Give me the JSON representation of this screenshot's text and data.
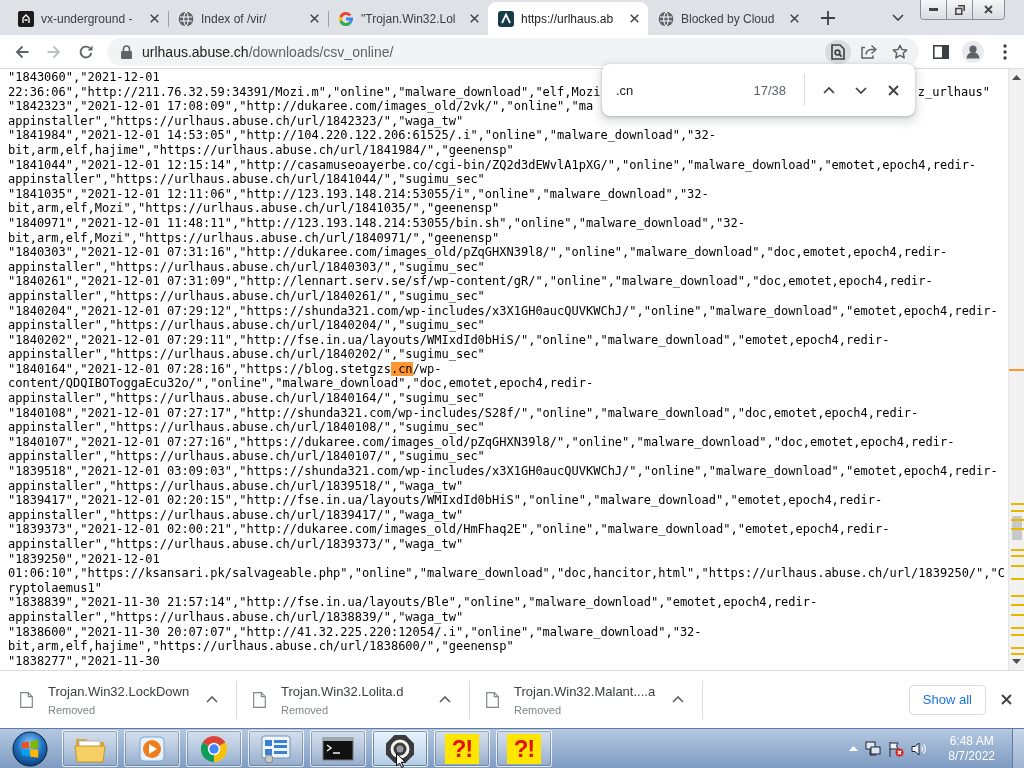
{
  "tabs": [
    {
      "kind": "square",
      "title": "vx-underground -",
      "selected": false
    },
    {
      "kind": "globe",
      "title": "Index of /vir/",
      "selected": false
    },
    {
      "kind": "g",
      "title": "\"Trojan.Win32.Lol",
      "selected": false
    },
    {
      "kind": "caret",
      "title": "https://urlhaus.ab",
      "selected": true
    },
    {
      "kind": "globe",
      "title": "Blocked by Cloud",
      "selected": false
    }
  ],
  "toolbar": {
    "nav": [
      {
        "kind": "back",
        "disabled": false
      },
      {
        "kind": "forward",
        "disabled": true
      },
      {
        "kind": "reload",
        "disabled": false
      }
    ],
    "address": {
      "host": "urlhaus.abuse.ch",
      "path": "/downloads/csv_online/"
    },
    "omnibox_icons": [
      {
        "kind": "find",
        "active": true
      },
      {
        "kind": "share",
        "active": false
      },
      {
        "kind": "star",
        "active": false
      }
    ]
  },
  "find_bar": {
    "query": ".cn",
    "count": "17/38"
  },
  "lines": [
    {
      "kind": "text",
      "text": "\"1843060\",\"2021-12-01"
    },
    {
      "kind": "covered",
      "segments": [
        "22:36:06\",\"http://211.76.32.59:34391/Mozi.m\",\"online\",\"malware_download\",\"elf,Mozi",
        "z_urlhaus\""
      ]
    },
    {
      "kind": "text",
      "text": "\"1842323\",\"2021-12-01 17:08:09\",\"http://dukaree.com/images_old/2vk/\",\"online\",\"ma"
    },
    {
      "kind": "text",
      "text": "appinstaller\",\"https://urlhaus.abuse.ch/url/1842323/\",\"waga_tw\""
    },
    {
      "kind": "text",
      "text": "\"1841984\",\"2021-12-01 14:53:05\",\"http://104.220.122.206:61525/.i\",\"online\",\"malware_download\",\"32-"
    },
    {
      "kind": "text",
      "text": "bit,arm,elf,hajime\",\"https://urlhaus.abuse.ch/url/1841984/\",\"geenensp\""
    },
    {
      "kind": "text",
      "text": "\"1841044\",\"2021-12-01 12:15:14\",\"http://casamuseoayerbe.co/cgi-bin/ZQ2d3dEWvlA1pXG/\",\"online\",\"malware_download\",\"emotet,epoch4,redir-"
    },
    {
      "kind": "text",
      "text": "appinstaller\",\"https://urlhaus.abuse.ch/url/1841044/\",\"sugimu_sec\""
    },
    {
      "kind": "text",
      "text": "\"1841035\",\"2021-12-01 12:11:06\",\"http://123.193.148.214:53055/i\",\"online\",\"malware_download\",\"32-"
    },
    {
      "kind": "text",
      "text": "bit,arm,elf,Mozi\",\"https://urlhaus.abuse.ch/url/1841035/\",\"geenensp\""
    },
    {
      "kind": "text",
      "text": "\"1840971\",\"2021-12-01 11:48:11\",\"http://123.193.148.214:53055/bin.sh\",\"online\",\"malware_download\",\"32-"
    },
    {
      "kind": "text",
      "text": "bit,arm,elf,Mozi\",\"https://urlhaus.abuse.ch/url/1840971/\",\"geenensp\""
    },
    {
      "kind": "text",
      "text": "\"1840303\",\"2021-12-01 07:31:16\",\"http://dukaree.com/images_old/pZqGHXN39l8/\",\"online\",\"malware_download\",\"doc,emotet,epoch4,redir-"
    },
    {
      "kind": "text",
      "text": "appinstaller\",\"https://urlhaus.abuse.ch/url/1840303/\",\"sugimu_sec\""
    },
    {
      "kind": "text",
      "text": "\"1840261\",\"2021-12-01 07:31:09\",\"http://lennart.serv.se/sf/wp-content/gR/\",\"online\",\"malware_download\",\"doc,emotet,epoch4,redir-"
    },
    {
      "kind": "text",
      "text": "appinstaller\",\"https://urlhaus.abuse.ch/url/1840261/\",\"sugimu_sec\""
    },
    {
      "kind": "text",
      "text": "\"1840204\",\"2021-12-01 07:29:12\",\"https://shunda321.com/wp-includes/x3X1GH0aucQUVKWChJ/\",\"online\",\"malware_download\",\"emotet,epoch4,redir-"
    },
    {
      "kind": "text",
      "text": "appinstaller\",\"https://urlhaus.abuse.ch/url/1840204/\",\"sugimu_sec\""
    },
    {
      "kind": "text",
      "text": "\"1840202\",\"2021-12-01 07:29:11\",\"http://fse.in.ua/layouts/WMIxdId0bHiS/\",\"online\",\"malware_download\",\"emotet,epoch4,redir-"
    },
    {
      "kind": "text",
      "text": "appinstaller\",\"https://urlhaus.abuse.ch/url/1840202/\",\"sugimu_sec\""
    },
    {
      "kind": "match",
      "before": "\"1840164\",\"2021-12-01 07:28:16\",\"https://blog.stetgzs",
      "match": ".cn",
      "after": "/wp-"
    },
    {
      "kind": "text",
      "text": "content/QDQIBOToggaEcu32o/\",\"online\",\"malware_download\",\"doc,emotet,epoch4,redir-"
    },
    {
      "kind": "text",
      "text": "appinstaller\",\"https://urlhaus.abuse.ch/url/1840164/\",\"sugimu_sec\""
    },
    {
      "kind": "text",
      "text": "\"1840108\",\"2021-12-01 07:27:17\",\"http://shunda321.com/wp-includes/S28f/\",\"online\",\"malware_download\",\"doc,emotet,epoch4,redir-"
    },
    {
      "kind": "text",
      "text": "appinstaller\",\"https://urlhaus.abuse.ch/url/1840108/\",\"sugimu_sec\""
    },
    {
      "kind": "text",
      "text": "\"1840107\",\"2021-12-01 07:27:16\",\"https://dukaree.com/images_old/pZqGHXN39l8/\",\"online\",\"malware_download\",\"doc,emotet,epoch4,redir-"
    },
    {
      "kind": "text",
      "text": "appinstaller\",\"https://urlhaus.abuse.ch/url/1840107/\",\"sugimu_sec\""
    },
    {
      "kind": "text",
      "text": "\"1839518\",\"2021-12-01 03:09:03\",\"https://shunda321.com/wp-includes/x3X1GH0aucQUVKWChJ/\",\"online\",\"malware_download\",\"emotet,epoch4,redir-"
    },
    {
      "kind": "text",
      "text": "appinstaller\",\"https://urlhaus.abuse.ch/url/1839518/\",\"waga_tw\""
    },
    {
      "kind": "text",
      "text": "\"1839417\",\"2021-12-01 02:20:15\",\"http://fse.in.ua/layouts/WMIxdId0bHiS\",\"online\",\"malware_download\",\"emotet,epoch4,redir-"
    },
    {
      "kind": "text",
      "text": "appinstaller\",\"https://urlhaus.abuse.ch/url/1839417/\",\"waga_tw\""
    },
    {
      "kind": "text",
      "text": "\"1839373\",\"2021-12-01 02:00:21\",\"http://dukaree.com/images_old/HmFhaq2E\",\"online\",\"malware_download\",\"emotet,epoch4,redir-"
    },
    {
      "kind": "text",
      "text": "appinstaller\",\"https://urlhaus.abuse.ch/url/1839373/\",\"waga_tw\""
    },
    {
      "kind": "text",
      "text": "\"1839250\",\"2021-12-01"
    },
    {
      "kind": "text",
      "text": "01:06:10\",\"https://ksansari.pk/salvageable.php\",\"online\",\"malware_download\",\"doc,hancitor,html\",\"https://urlhaus.abuse.ch/url/1839250/\",\"C"
    },
    {
      "kind": "text",
      "text": "ryptolaemus1\""
    },
    {
      "kind": "text",
      "text": "\"1838839\",\"2021-11-30 21:57:14\",\"http://fse.in.ua/layouts/Ble\",\"online\",\"malware_download\",\"emotet,epoch4,redir-"
    },
    {
      "kind": "text",
      "text": "appinstaller\",\"https://urlhaus.abuse.ch/url/1838839/\",\"waga_tw\""
    },
    {
      "kind": "text",
      "text": "\"1838600\",\"2021-11-30 20:07:07\",\"http://41.32.225.220:12054/.i\",\"online\",\"malware_download\",\"32-"
    },
    {
      "kind": "text",
      "text": "bit,arm,elf,hajime\",\"https://urlhaus.abuse.ch/url/1838600/\",\"geenensp\""
    },
    {
      "kind": "text",
      "text": "\"1838277\",\"2021-11-30"
    }
  ],
  "downloads": {
    "items": [
      {
        "name": "Trojan.Win32.LockDown",
        "status": "Removed"
      },
      {
        "name": "Trojan.Win32.Lolita.d",
        "status": "Removed"
      },
      {
        "name": "Trojan.Win32.Malant....a",
        "status": "Removed"
      }
    ],
    "show_all": "Show all"
  },
  "taskbar": {
    "apps": [
      {
        "kind": "folder",
        "selected": false
      },
      {
        "kind": "media",
        "selected": false
      },
      {
        "kind": "browser",
        "selected": false
      },
      {
        "kind": "panel",
        "selected": false
      },
      {
        "kind": "terminal",
        "selected": false
      },
      {
        "kind": "octagon",
        "selected": true
      },
      {
        "kind": "alert",
        "label": "?!",
        "selected": false
      },
      {
        "kind": "alert",
        "label": "?!",
        "selected": false
      }
    ],
    "clock": {
      "time": "6:48 AM",
      "date": "8/7/2022"
    }
  }
}
